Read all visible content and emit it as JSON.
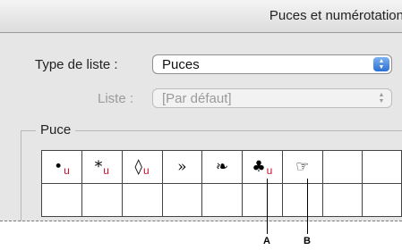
{
  "dialog": {
    "title": "Puces et numérotation"
  },
  "list_type": {
    "label": "Type de liste :",
    "value": "Puces"
  },
  "list": {
    "label": "Liste :",
    "value": "[Par défaut]"
  },
  "bullet_group": {
    "label": "Puce"
  },
  "bullets": [
    {
      "glyph": "•",
      "sub": "u",
      "icon": "bullet-dot-icon"
    },
    {
      "glyph": "*",
      "sub": "u",
      "icon": "asterisk-icon"
    },
    {
      "glyph": "◊",
      "sub": "u",
      "icon": "lozenge-icon"
    },
    {
      "glyph": "»",
      "sub": "",
      "icon": "guillemet-icon"
    },
    {
      "glyph": "❧",
      "sub": "",
      "icon": "floral-heart-icon"
    },
    {
      "glyph": "♣",
      "sub": "u",
      "icon": "club-icon"
    },
    {
      "glyph": "☞",
      "sub": "",
      "icon": "pointing-hand-icon"
    },
    {
      "glyph": "",
      "sub": "",
      "icon": ""
    },
    {
      "glyph": "",
      "sub": "",
      "icon": ""
    }
  ],
  "callouts": {
    "a": "A",
    "b": "B"
  },
  "colors": {
    "accent": "#2a6fd2",
    "font_marker": "#c8102e"
  }
}
